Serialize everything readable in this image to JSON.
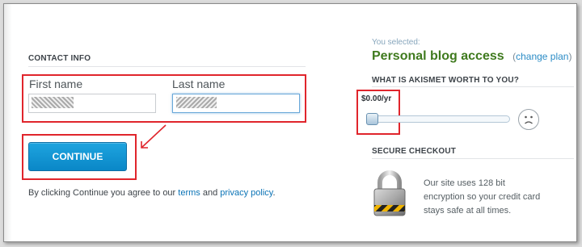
{
  "contact": {
    "heading": "CONTACT INFO",
    "first_name_label": "First name",
    "last_name_label": "Last name",
    "first_name_value": "",
    "last_name_value": ""
  },
  "actions": {
    "continue_label": "CONTINUE"
  },
  "terms": {
    "prefix": "By clicking Continue you agree to our",
    "terms_link": "terms",
    "and": "and",
    "privacy_link": "privacy policy",
    "suffix": "."
  },
  "plan": {
    "selected_label": "You selected:",
    "name": "Personal blog access",
    "change_open": "(",
    "change_link": "change plan",
    "change_close": ")"
  },
  "pricing": {
    "question": "WHAT IS AKISMET WORTH TO YOU?",
    "value": "$0.00/yr",
    "slider_fraction": 0.0,
    "face_icon": "sad-face-icon"
  },
  "secure": {
    "heading": "SECURE CHECKOUT",
    "text": "Our site uses 128 bit encryption so your credit card stays safe at all times.",
    "icon": "padlock-icon"
  },
  "colors": {
    "annotation_red": "#e0252c",
    "button_blue": "#1597d4",
    "plan_green": "#3f7a1e",
    "link_blue": "#0a73b6"
  }
}
